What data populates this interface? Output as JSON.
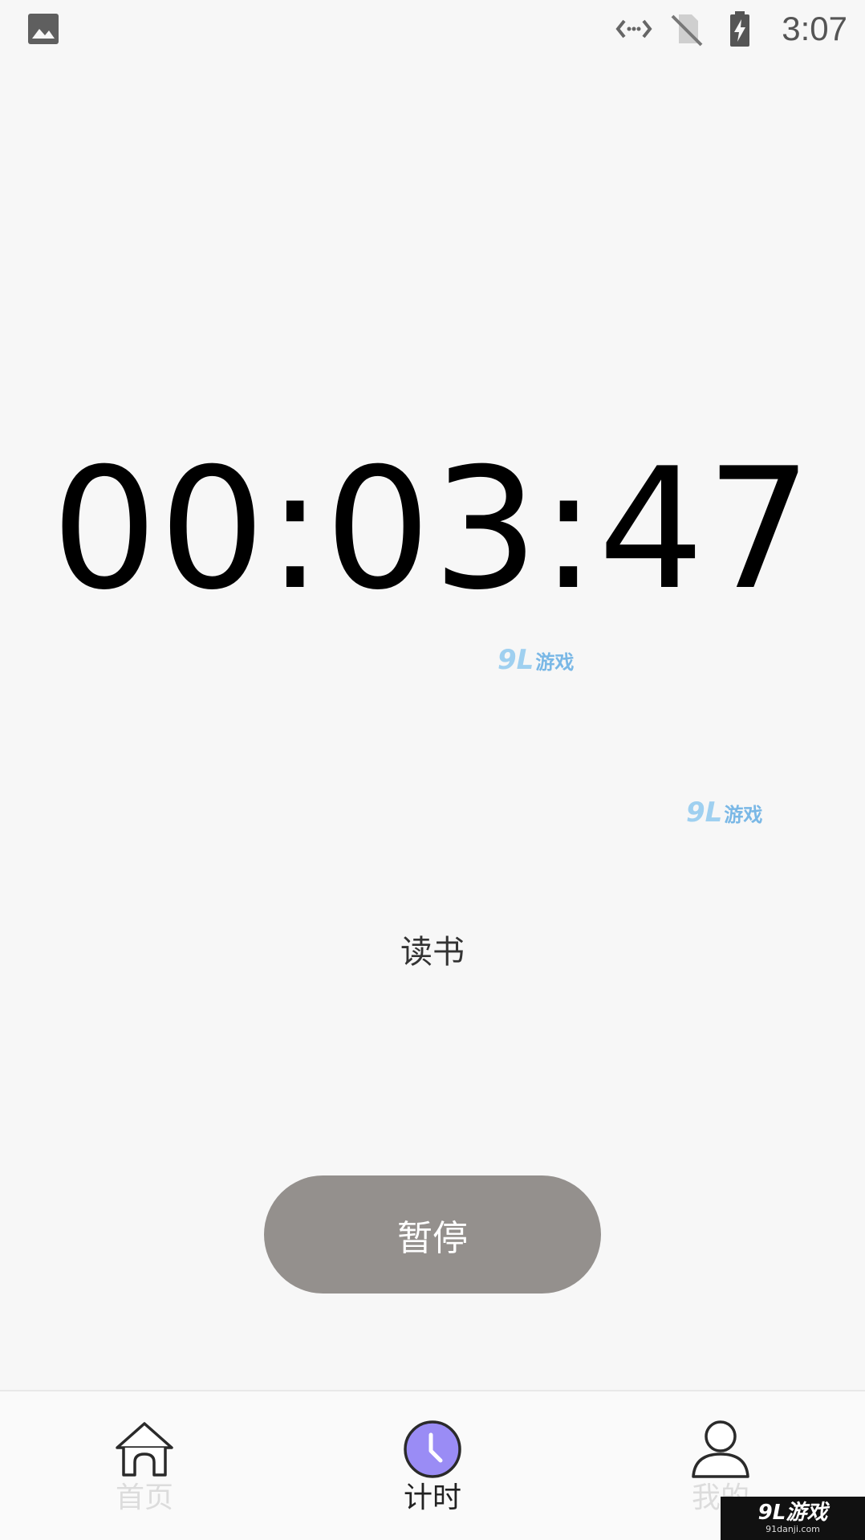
{
  "status_bar": {
    "time": "3:07",
    "icons": [
      "gallery-icon",
      "data-transfer-icon",
      "no-sim-icon",
      "battery-charging-icon"
    ]
  },
  "timer": {
    "display": "00:03:47"
  },
  "task": {
    "label": "读书"
  },
  "controls": {
    "pause_label": "暂停",
    "pause_color": "#94908d"
  },
  "bottom_nav": {
    "items": [
      {
        "label": "首页",
        "icon": "home-icon",
        "active": false
      },
      {
        "label": "计时",
        "icon": "clock-icon",
        "active": true
      },
      {
        "label": "我的",
        "icon": "person-icon",
        "active": false
      }
    ],
    "active_color": "#9a8cf5"
  },
  "watermarks": [
    {
      "main": "9L",
      "sub": "游戏"
    },
    {
      "main": "9L",
      "sub": "游戏"
    }
  ],
  "corner_logo": {
    "main": "9L游戏",
    "sub": "91danji.com"
  }
}
